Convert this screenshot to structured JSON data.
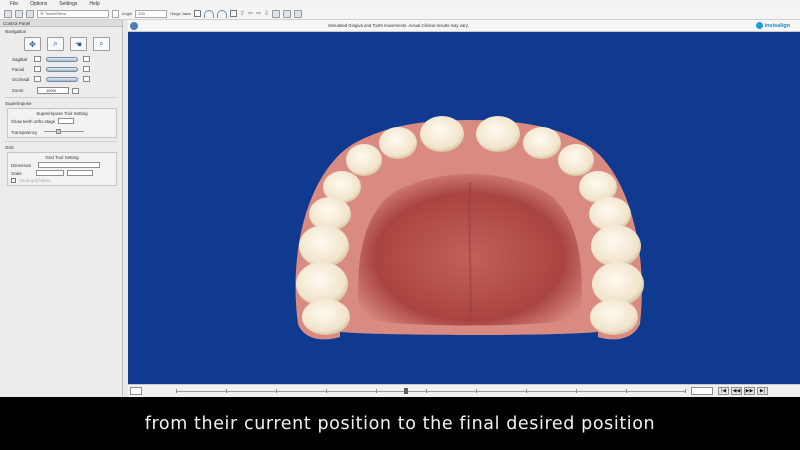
{
  "menu": {
    "items": [
      "File",
      "Options",
      "Settings",
      "Help"
    ]
  },
  "toolbar": {
    "view_select": "Ⓝ Tooth/Ortho",
    "angle_label": "Angle",
    "angle_value": "100",
    "hinge_label": "Hinge Jaws"
  },
  "panel": {
    "title": "Control Panel",
    "navigation": {
      "title": "Navigation",
      "rows": [
        {
          "label": "Sagittal"
        },
        {
          "label": "Facial"
        },
        {
          "label": "Occlusal"
        }
      ],
      "zoom_label": "Zoom",
      "zoom_value": "100%"
    },
    "superimpose": {
      "title": "Superimpose",
      "group_head": "Superimpose Tool Setting",
      "stage_label": "Show teeth ortho stage",
      "transparency_label": "Transparency"
    },
    "grid": {
      "title": "Grid",
      "group_head": "Grid Tool Setting",
      "dimension_label": "Dimension",
      "scale_label": "Scale",
      "option_label": "Show grid labels"
    }
  },
  "viewport": {
    "disclaimer": "Simulated Gingiva and Tooth movements. Actual Clinical results may vary.",
    "brand": "invisalign",
    "colors": {
      "background": "#0f3a8f",
      "gum": "#d98b82",
      "palate": "#b94f4a",
      "tooth": "#f4ead8"
    }
  },
  "timeline": {
    "stage_value": "",
    "controls": [
      "|◀",
      "◀◀",
      "▶▶",
      "▶|"
    ]
  },
  "subtitle": "from their current position to the final desired position"
}
